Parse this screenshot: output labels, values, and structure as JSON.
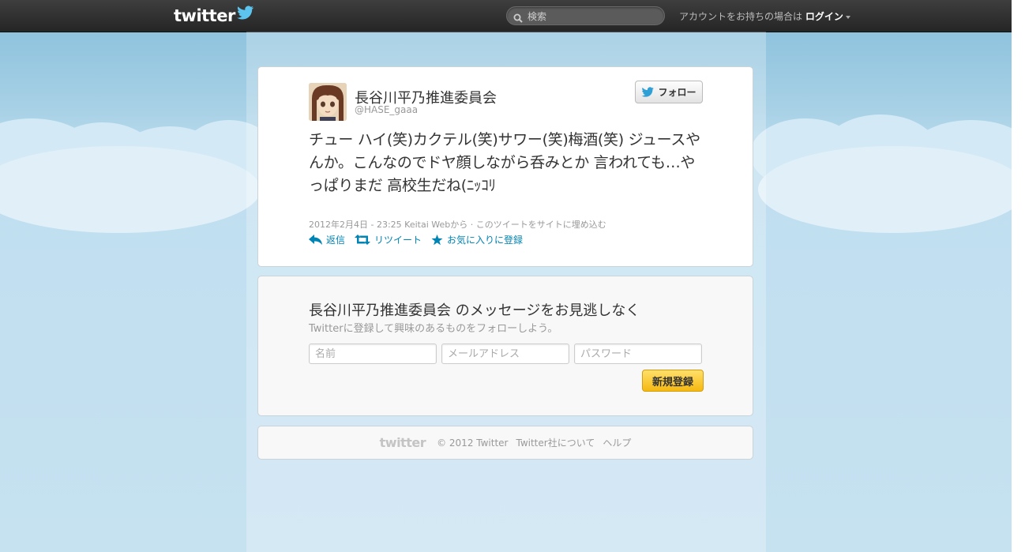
{
  "header": {
    "logo_text": "twitter",
    "search_placeholder": "検索",
    "login_prompt": "アカウントをお持ちの場合は",
    "login_label": "ログイン"
  },
  "tweet": {
    "display_name": "長谷川平乃推進委員会",
    "screen_name": "@HASE_gaaa",
    "follow_label": "フォロー",
    "text": "チュー ハイ(笑)カクテル(笑)サワー(笑)梅酒(笑) ジュースやんか。こんなのでドヤ顔しながら呑みとか 言われても…やっぱりまだ 高校生だね(ﾆｯｺﾘ",
    "timestamp": "2012年2月4日 - 23:25",
    "source": "Keitai Webから",
    "separator": "·",
    "embed_label": "このツイートをサイトに埋め込む",
    "reply_label": "返信",
    "retweet_label": "リツイート",
    "favorite_label": "お気に入りに登録"
  },
  "signup": {
    "title": "長谷川平乃推進委員会 のメッセージをお見逃しなく",
    "subtitle": "Twitterに登録して興味のあるものをフォローしよう。",
    "name_placeholder": "名前",
    "email_placeholder": "メールアドレス",
    "password_placeholder": "パスワード",
    "button_label": "新規登録"
  },
  "footer": {
    "logo_text": "twitter",
    "copyright": "© 2012 Twitter",
    "about_label": "Twitter社について",
    "help_label": "ヘルプ"
  },
  "colors": {
    "link": "#0084b4",
    "topbar": "#2f2f2f",
    "sky": "#c6e2f1",
    "signup_button": "#f5b910"
  },
  "icons": [
    "search-icon",
    "twitter-bird-icon",
    "reply-icon",
    "retweet-icon",
    "star-icon",
    "chevron-down-icon"
  ]
}
